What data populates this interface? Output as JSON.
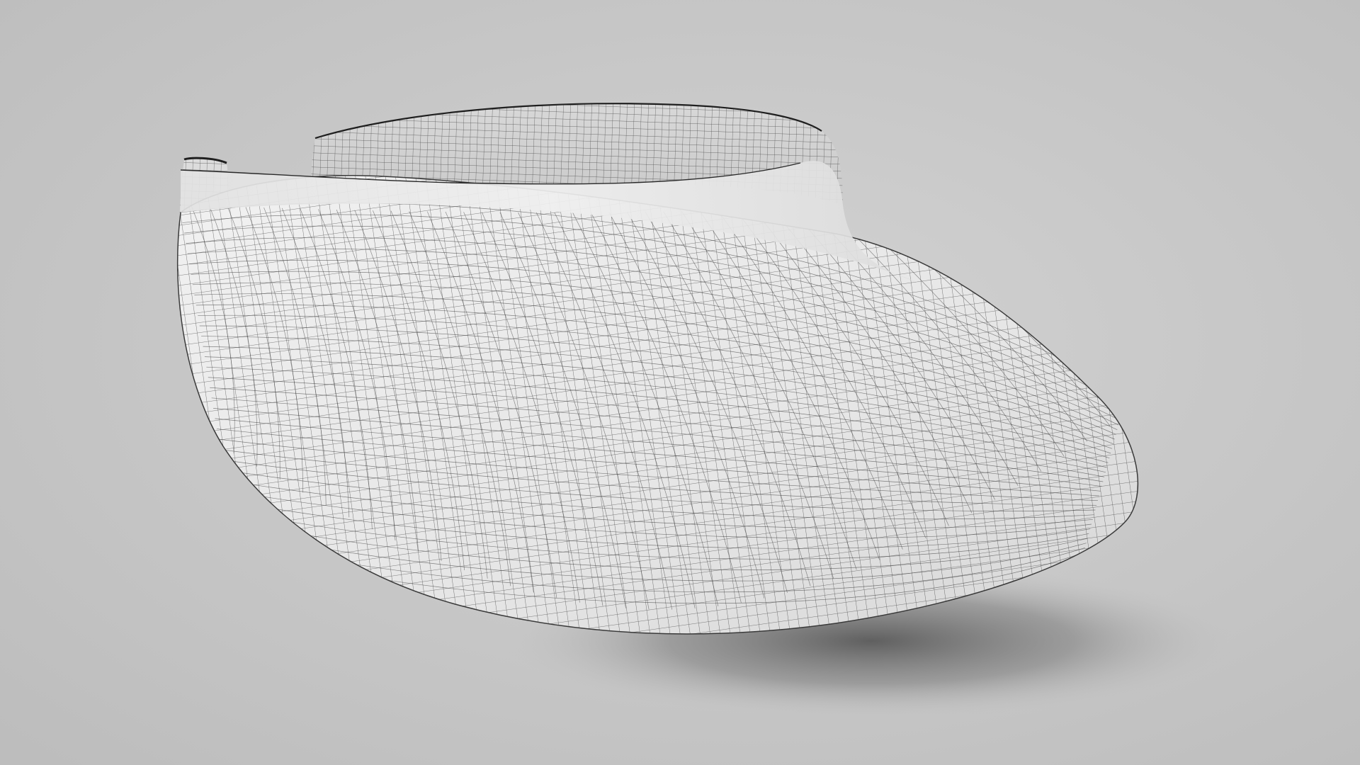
{
  "scene": {
    "subject": "visor-wireframe-render",
    "background_color": "#c4c4c4",
    "surface_color": "#ececec",
    "wire_color": "#2a2a2a",
    "shadow_color": "#5f5f5f"
  }
}
